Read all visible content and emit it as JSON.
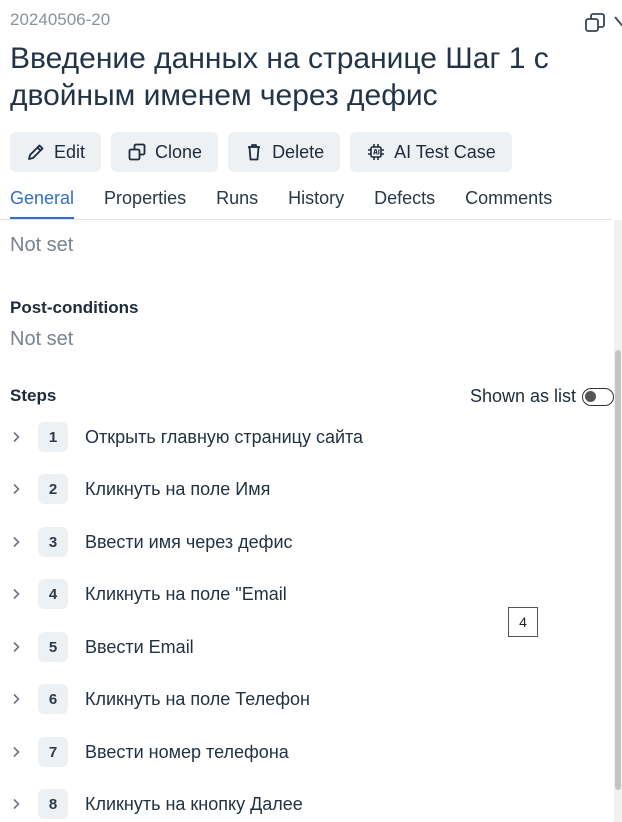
{
  "case_id": "20240506-20",
  "title": "Введение данных на странице Шаг 1 с двойным именем через дефис",
  "toolbar": {
    "edit_label": "Edit",
    "clone_label": "Clone",
    "delete_label": "Delete",
    "ai_label": "AI Test Case"
  },
  "tabs": [
    {
      "label": "General",
      "active": true
    },
    {
      "label": "Properties",
      "active": false
    },
    {
      "label": "Runs",
      "active": false
    },
    {
      "label": "History",
      "active": false
    },
    {
      "label": "Defects",
      "active": false
    },
    {
      "label": "Comments",
      "active": false
    }
  ],
  "preconditions_value": "Not set",
  "postconditions": {
    "label": "Post-conditions",
    "value": "Not set"
  },
  "steps": {
    "title": "Steps",
    "shown_as_list_label": "Shown as list",
    "shown_as_list_on": false,
    "items": [
      {
        "number": "1",
        "text": "Открыть главную страницу сайта"
      },
      {
        "number": "2",
        "text": "Кликнуть на поле Имя"
      },
      {
        "number": "3",
        "text": "Ввести имя через дефис"
      },
      {
        "number": "4",
        "text": "Кликнуть на поле \"Email"
      },
      {
        "number": "5",
        "text": "Ввести Email"
      },
      {
        "number": "6",
        "text": "Кликнуть на поле Телефон"
      },
      {
        "number": "7",
        "text": "Ввести номер телефона"
      },
      {
        "number": "8",
        "text": "Кликнуть на кнопку Далее"
      }
    ]
  },
  "page_badge": "4",
  "colors": {
    "accent": "#2f6fce",
    "text": "#1e2b3c",
    "muted": "#7b838d",
    "button_bg": "#eef1f4"
  },
  "icons": {
    "edit": "pencil-icon",
    "clone": "clone-icon",
    "delete": "trash-icon",
    "ai": "chip-icon",
    "window": "restore-window-icon",
    "step": "chevron-right-icon"
  }
}
